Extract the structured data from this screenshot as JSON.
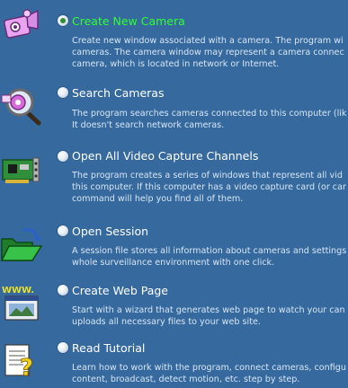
{
  "items": [
    {
      "title": "Create New Camera",
      "selected": true,
      "icon": "camera-icon",
      "desc": [
        "Create new window associated with a camera. The program wi",
        "cameras. The camera window may represent a camera connec",
        "camera, which is located in network or Internet."
      ]
    },
    {
      "title": "Search Cameras",
      "selected": false,
      "icon": "magnifier-icon",
      "desc": [
        "The program searches cameras connected to this computer (lik",
        "It doesn't search network cameras."
      ]
    },
    {
      "title": "Open All Video Capture Channels",
      "selected": false,
      "icon": "capture-card-icon",
      "desc": [
        "The program creates a series of windows that represent all vid",
        "this computer. If this computer has a video capture card (or car",
        "command will help you find all of them."
      ]
    },
    {
      "title": "Open Session",
      "selected": false,
      "icon": "folder-open-icon",
      "desc": [
        "A session file stores all information about cameras and settings",
        "whole surveillance environment with one click."
      ]
    },
    {
      "title": "Create Web Page",
      "selected": false,
      "icon": "web-page-icon",
      "icon_text": "WWW.",
      "desc": [
        "Start with a wizard that generates web page to watch your can",
        "uploads all necessary files to your web site."
      ]
    },
    {
      "title": "Read Tutorial",
      "selected": false,
      "icon": "tutorial-icon",
      "icon_text": "?",
      "desc": [
        "Learn how to work with the program, connect cameras, configu",
        "content, broadcast, detect motion, etc. step by step."
      ]
    }
  ],
  "colors": {
    "background": "#366a9f",
    "selected_title": "#31ff31",
    "title": "#ffffff",
    "description": "#d7e5f3"
  }
}
